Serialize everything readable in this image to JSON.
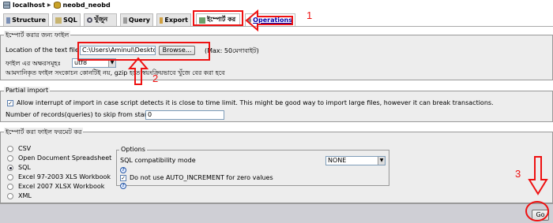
{
  "breadcrumb": {
    "server": "localhost",
    "database": "neobd_neobd"
  },
  "tabs": [
    {
      "label": "Structure"
    },
    {
      "label": "SQL"
    },
    {
      "label": "খুঁজুন"
    },
    {
      "label": "Query"
    },
    {
      "label": "Export"
    },
    {
      "label": "ইম্পোর্ট কর"
    },
    {
      "label": "Operations"
    }
  ],
  "file_section": {
    "legend": "ইম্পোর্ট করার জন্য ফাইল",
    "location_label": "Location of the text file",
    "file_path": "C:\\Users\\Aminul\\Desktop",
    "browse_label": "Browse...",
    "max_note": "(Max: 50মেগাবাইট)",
    "charset_label": "ফাইল এর অক্ষরসমূহঃ",
    "charset_value": "utf8",
    "compression_note": "আমদানিকৃত ফাইল সংকোচন কোনটিই নয়, gzip হতে স্বয়ংক্রিয়ভাবে খুঁজে বের করা হবে"
  },
  "partial_section": {
    "legend": "Partial import",
    "allow_interrupt_text": "Allow interrupt of import in case script detects it is close to time limit. This might be good way to import large files, however it can break transactions.",
    "allow_interrupt_checked": true,
    "skip_label": "Number of records(queries) to skip from start",
    "skip_value": "0"
  },
  "format_section": {
    "legend": "ইম্পোর্ট করা ফাইল ফরমেট কর",
    "formats": [
      "CSV",
      "Open Document Spreadsheet",
      "SQL",
      "Excel 97-2003 XLS Workbook",
      "Excel 2007 XLSX Workbook",
      "XML"
    ],
    "selected_format": "SQL",
    "options_legend": "Options",
    "sql_compat_label": "SQL compatibility mode",
    "sql_compat_value": "NONE",
    "auto_increment_label": "Do not use AUTO_INCREMENT for zero values",
    "auto_increment_checked": true
  },
  "footer": {
    "go_label": "Go"
  },
  "annotations": {
    "n1": "1",
    "n2": "2",
    "n3": "3",
    "color": "#e11111"
  }
}
